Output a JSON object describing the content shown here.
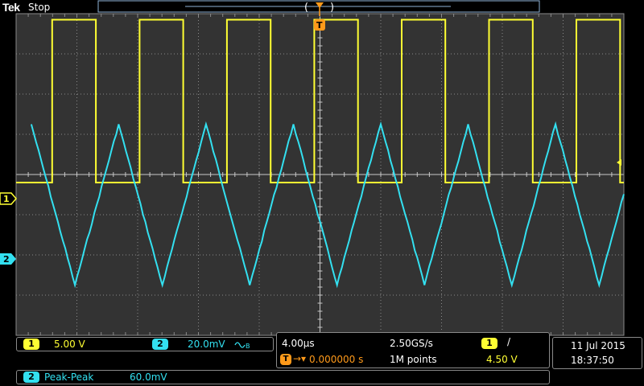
{
  "header": {
    "brand": "Tek",
    "state": "Stop"
  },
  "markers": {
    "ch1": "1",
    "ch2": "2",
    "trigger": "T"
  },
  "channels": [
    {
      "id": "1",
      "scale": "5.00 V",
      "color": "#ffff33"
    },
    {
      "id": "2",
      "scale": "20.0mV",
      "color": "#33e0f0",
      "bw_icon": "bandwidth-limit-icon"
    }
  ],
  "timebase": {
    "scale": "4.00µs",
    "sample_rate": "2.50GS/s",
    "position": "0.000000 s",
    "record_length": "1M points"
  },
  "trigger": {
    "source": "1",
    "slope_icon": "rising-edge-icon",
    "slope_glyph": "/",
    "level": "4.50 V"
  },
  "datetime": {
    "date": "11 Jul  2015",
    "time": "18:37:50"
  },
  "measurement": {
    "channel": "2",
    "label": "Peak-Peak",
    "value": "60.0mV"
  },
  "waveform": {
    "ch1_square": {
      "period_us": 5.75,
      "high_div": 3.85,
      "low_div": -0.2,
      "first_rise_us": -14.75
    },
    "ch2_triangle": {
      "period_us": 5.75,
      "peak_div": 1.25,
      "trough_div": -2.75,
      "first_peak_us": -19.0
    }
  },
  "colors": {
    "ch1": "#ffff33",
    "ch2": "#33e0f0",
    "grid": "#8a8a8a",
    "background": "#333333",
    "trigger": "#ff9a1a"
  }
}
